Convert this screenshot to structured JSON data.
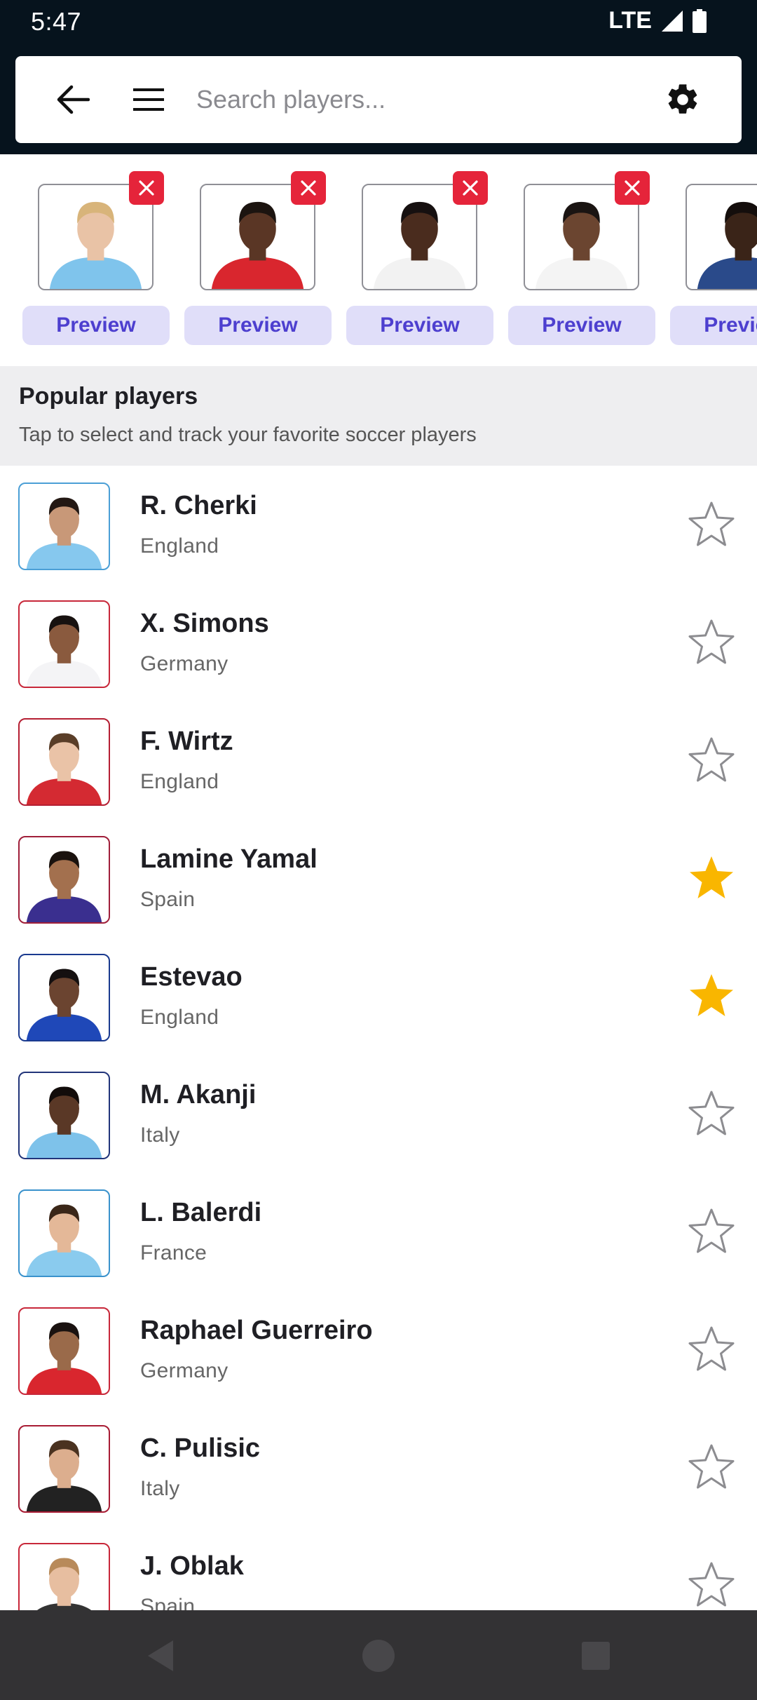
{
  "status": {
    "time": "5:47",
    "network": "LTE"
  },
  "search": {
    "placeholder": "Search players..."
  },
  "selected": [
    {
      "name": "selected-player-1",
      "preview_label": "Preview",
      "kit": "#7fc4ec",
      "skin": "#e9c3a6",
      "hair": "#d8b47a"
    },
    {
      "name": "selected-player-2",
      "preview_label": "Preview",
      "kit": "#d9262e",
      "skin": "#5a3625",
      "hair": "#1c1410"
    },
    {
      "name": "selected-player-3",
      "preview_label": "Preview",
      "kit": "#f2f2f2",
      "skin": "#4a2c1e",
      "hair": "#161010"
    },
    {
      "name": "selected-player-4",
      "preview_label": "Preview",
      "kit": "#f4f4f4",
      "skin": "#6b4530",
      "hair": "#1a1412"
    },
    {
      "name": "selected-player-5",
      "preview_label": "Preview",
      "kit": "#2a4a8a",
      "skin": "#3a2418",
      "hair": "#140e0c"
    }
  ],
  "popular": {
    "title": "Popular players",
    "subtitle": "Tap to select and track your favorite soccer players"
  },
  "players": [
    {
      "name": "R. Cherki",
      "country": "England",
      "favorite": false,
      "border": "#4b9fd6",
      "kit": "#86c8ee",
      "skin": "#c89878",
      "hair": "#231813"
    },
    {
      "name": "X. Simons",
      "country": "Germany",
      "favorite": false,
      "border": "#c8283a",
      "kit": "#f4f4f6",
      "skin": "#8a5a3e",
      "hair": "#181210"
    },
    {
      "name": "F. Wirtz",
      "country": "England",
      "favorite": false,
      "border": "#b51f33",
      "kit": "#d42a32",
      "skin": "#eac3a7",
      "hair": "#5a3e28"
    },
    {
      "name": "Lamine Yamal",
      "country": "Spain",
      "favorite": true,
      "border": "#a01f3a",
      "kit": "#3a2f8f",
      "skin": "#a3704e",
      "hair": "#1a120e"
    },
    {
      "name": "Estevao",
      "country": "England",
      "favorite": true,
      "border": "#1a3a8f",
      "kit": "#1f48b8",
      "skin": "#6b4430",
      "hair": "#151010"
    },
    {
      "name": "M. Akanji",
      "country": "Italy",
      "favorite": false,
      "border": "#22357a",
      "kit": "#7ec2ea",
      "skin": "#5a3826",
      "hair": "#120c0a"
    },
    {
      "name": "L. Balerdi",
      "country": "France",
      "favorite": false,
      "border": "#3a92cc",
      "kit": "#8acbee",
      "skin": "#e4b898",
      "hair": "#3a2618"
    },
    {
      "name": "Raphael Guerreiro",
      "country": "Germany",
      "favorite": false,
      "border": "#c8283a",
      "kit": "#d9262e",
      "skin": "#9a6a4a",
      "hair": "#1a1210"
    },
    {
      "name": "C. Pulisic",
      "country": "Italy",
      "favorite": false,
      "border": "#a81c34",
      "kit": "#222222",
      "skin": "#dcae8e",
      "hair": "#4a3220"
    },
    {
      "name": "J. Oblak",
      "country": "Spain",
      "favorite": false,
      "border": "#c8283a",
      "kit": "#333333",
      "skin": "#e7bea0",
      "hair": "#b88a5a"
    }
  ],
  "colors": {
    "header_bg": "#06131d",
    "remove_red": "#e5243a",
    "preview_bg": "#e0def9",
    "preview_text": "#4d3fcf",
    "star_gold": "#f9b600",
    "star_outline": "#8c8c90",
    "nav_bg": "#333234"
  },
  "icons": {
    "back": "arrow-left-icon",
    "menu": "hamburger-menu-icon",
    "settings": "gear-icon",
    "remove": "close-icon",
    "favorite": "star-icon"
  }
}
